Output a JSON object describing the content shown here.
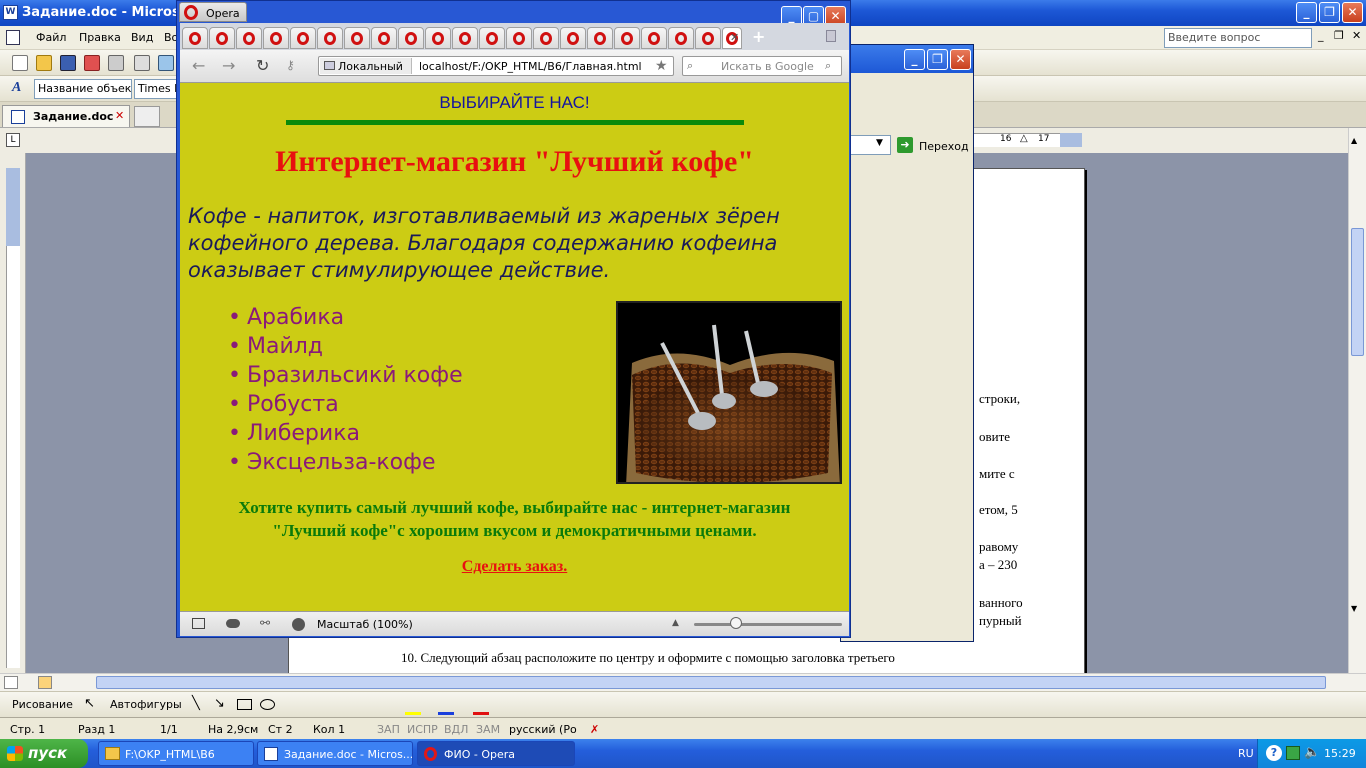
{
  "word": {
    "title": "Задание.doc - Microsoft",
    "menu": [
      "Файл",
      "Правка",
      "Вид",
      "Во"
    ],
    "help_placeholder": "Введите вопрос",
    "style_combo": "Название объек",
    "font_combo": "Times Ne",
    "doc_tab": "Задание.doc",
    "go_button": "Переход",
    "ruler_marks": [
      "16",
      "17"
    ],
    "doc_fragments": [
      "строки,",
      "овите",
      "мите с",
      "етом, 5",
      "равому",
      "а – 230",
      "ванного",
      "пурный"
    ],
    "doc_item_10": "10. Следующий абзац расположите по центру и оформите с помощью заголовка третьего",
    "draw_bar": {
      "draw_label": "Рисование",
      "autoshapes_label": "Автофигуры"
    },
    "status": {
      "page": "Стр. 1",
      "section": "Разд 1",
      "pages": "1/1",
      "at": "На 2,9см",
      "line": "Ст 2",
      "col": "Кол 1",
      "rec": "ЗАП",
      "trk": "ИСПР",
      "ext": "ВДЛ",
      "ovr": "ЗАМ",
      "lang": "русский (Ро"
    }
  },
  "opera": {
    "title_tab": "Opera",
    "zone_label": "Локальный",
    "url": "localhost/F:/OKP_HTML/B6/Главная.html",
    "search_placeholder": "Искать в Google",
    "zoom_label": "Масштаб (100%)"
  },
  "page": {
    "top_heading": "ВЫБИРАЙТЕ НАС!",
    "title": "Интернет-магазин \"Лучший кофе\"",
    "intro": "Кофе - напиток, изготавливаемый из жареных зёрен кофейного дерева. Благодаря содержанию кофеина оказывает стимулирующее действие.",
    "varieties": [
      "Арабика",
      "Майлд",
      "Бразильсикй кофе",
      "Робуста",
      "Либерика",
      "Эксцельза-кофе"
    ],
    "promo_line1": "Хотите купить самый лучший кофе, выбирайте нас - интернет-магазин",
    "promo_line2": "\"Лучший кофе\"с хорошим вкусом и демократичными ценами.",
    "order_link": "Сделать заказ."
  },
  "taskbar": {
    "start": "пуск",
    "tasks": [
      "F:\\OKP_HTML\\B6",
      "Задание.doc - Micros...",
      "ФИО - Opera"
    ],
    "lang": "RU",
    "clock": "15:29"
  },
  "colors": {
    "page_bg": "#cccc14",
    "title_red": "#e81010",
    "heading_blue": "#1414a0",
    "rule_green": "#0a8a0a",
    "list_purple": "#8a1a7a"
  }
}
